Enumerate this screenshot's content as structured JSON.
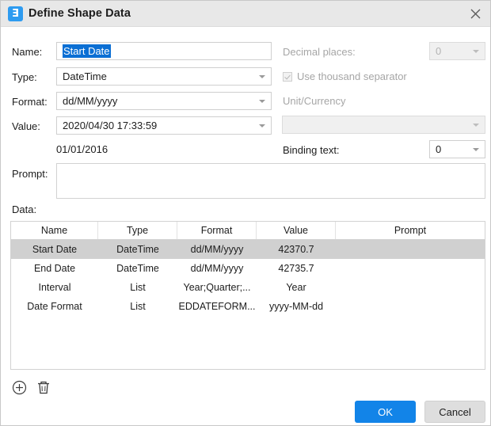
{
  "window": {
    "title": "Define Shape Data",
    "icon": "app-icon-visio",
    "icon_glyph": "Ǝ",
    "close_label": "close-icon"
  },
  "form": {
    "name_label": "Name:",
    "name_value": "Start Date",
    "name_selected": true,
    "type_label": "Type:",
    "type_value": "DateTime",
    "format_label": "Format:",
    "format_value": "dd/MM/yyyy",
    "value_label": "Value:",
    "value_value": "2020/04/30 17:33:59",
    "preview_value": "01/01/2016",
    "prompt_label": "Prompt:",
    "prompt_value": "",
    "decimal_places_label": "Decimal places:",
    "decimal_places_value": "0",
    "thousand_separator_label": "Use thousand separator",
    "thousand_separator_checked": true,
    "unit_currency_label": "Unit/Currency",
    "unit_currency_value": "",
    "binding_text_label": "Binding text:",
    "binding_text_value": "0",
    "data_label": "Data:"
  },
  "table": {
    "columns": [
      "Name",
      "Type",
      "Format",
      "Value",
      "Prompt"
    ],
    "rows": [
      {
        "name": "Start Date",
        "type": "DateTime",
        "format": "dd/MM/yyyy",
        "value": "42370.7",
        "prompt": "",
        "selected": true
      },
      {
        "name": "End Date",
        "type": "DateTime",
        "format": "dd/MM/yyyy",
        "value": "42735.7",
        "prompt": "",
        "selected": false
      },
      {
        "name": "Interval",
        "type": "List",
        "format": "Year;Quarter;...",
        "value": "Year",
        "prompt": "",
        "selected": false
      },
      {
        "name": "Date Format",
        "type": "List",
        "format": "EDDATEFORM...",
        "value": "yyyy-MM-dd",
        "prompt": "",
        "selected": false
      }
    ]
  },
  "toolbar": {
    "add_icon": "add-circle-icon",
    "delete_icon": "trash-icon"
  },
  "buttons": {
    "ok": "OK",
    "cancel": "Cancel"
  },
  "colors": {
    "accent": "#1284e8",
    "selection": "#0b6fd4",
    "row_selected": "#d0d0d0",
    "titlebar": "#e8e8e8",
    "icon_blue": "#2e9bf0"
  }
}
